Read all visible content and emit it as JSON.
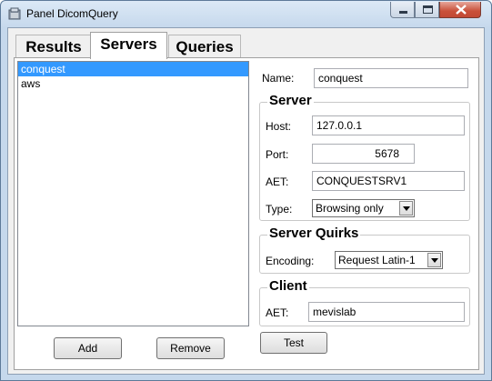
{
  "window": {
    "title": "Panel DicomQuery"
  },
  "tabs": [
    {
      "label": "Results",
      "active": false
    },
    {
      "label": "Servers",
      "active": true
    },
    {
      "label": "Queries",
      "active": false
    }
  ],
  "server_list": {
    "items": [
      {
        "label": "conquest",
        "selected": true
      },
      {
        "label": "aws",
        "selected": false
      }
    ],
    "add_label": "Add",
    "remove_label": "Remove"
  },
  "details": {
    "name_label": "Name:",
    "name_value": "conquest",
    "server": {
      "title": "Server",
      "host_label": "Host:",
      "host_value": "127.0.0.1",
      "port_label": "Port:",
      "port_value": "5678",
      "aet_label": "AET:",
      "aet_value": "CONQUESTSRV1",
      "type_label": "Type:",
      "type_value": "Browsing only"
    },
    "quirks": {
      "title": "Server Quirks",
      "encoding_label": "Encoding:",
      "encoding_value": "Request Latin-1"
    },
    "client": {
      "title": "Client",
      "aet_label": "AET:",
      "aet_value": "mevislab"
    },
    "test_label": "Test"
  },
  "icons": {
    "app": "application-icon",
    "minimize": "minimize-icon",
    "maximize": "maximize-icon",
    "close": "close-icon",
    "dropdown": "chevron-down-icon"
  },
  "colors": {
    "selection": "#3399ff",
    "close_button": "#c9503a"
  }
}
